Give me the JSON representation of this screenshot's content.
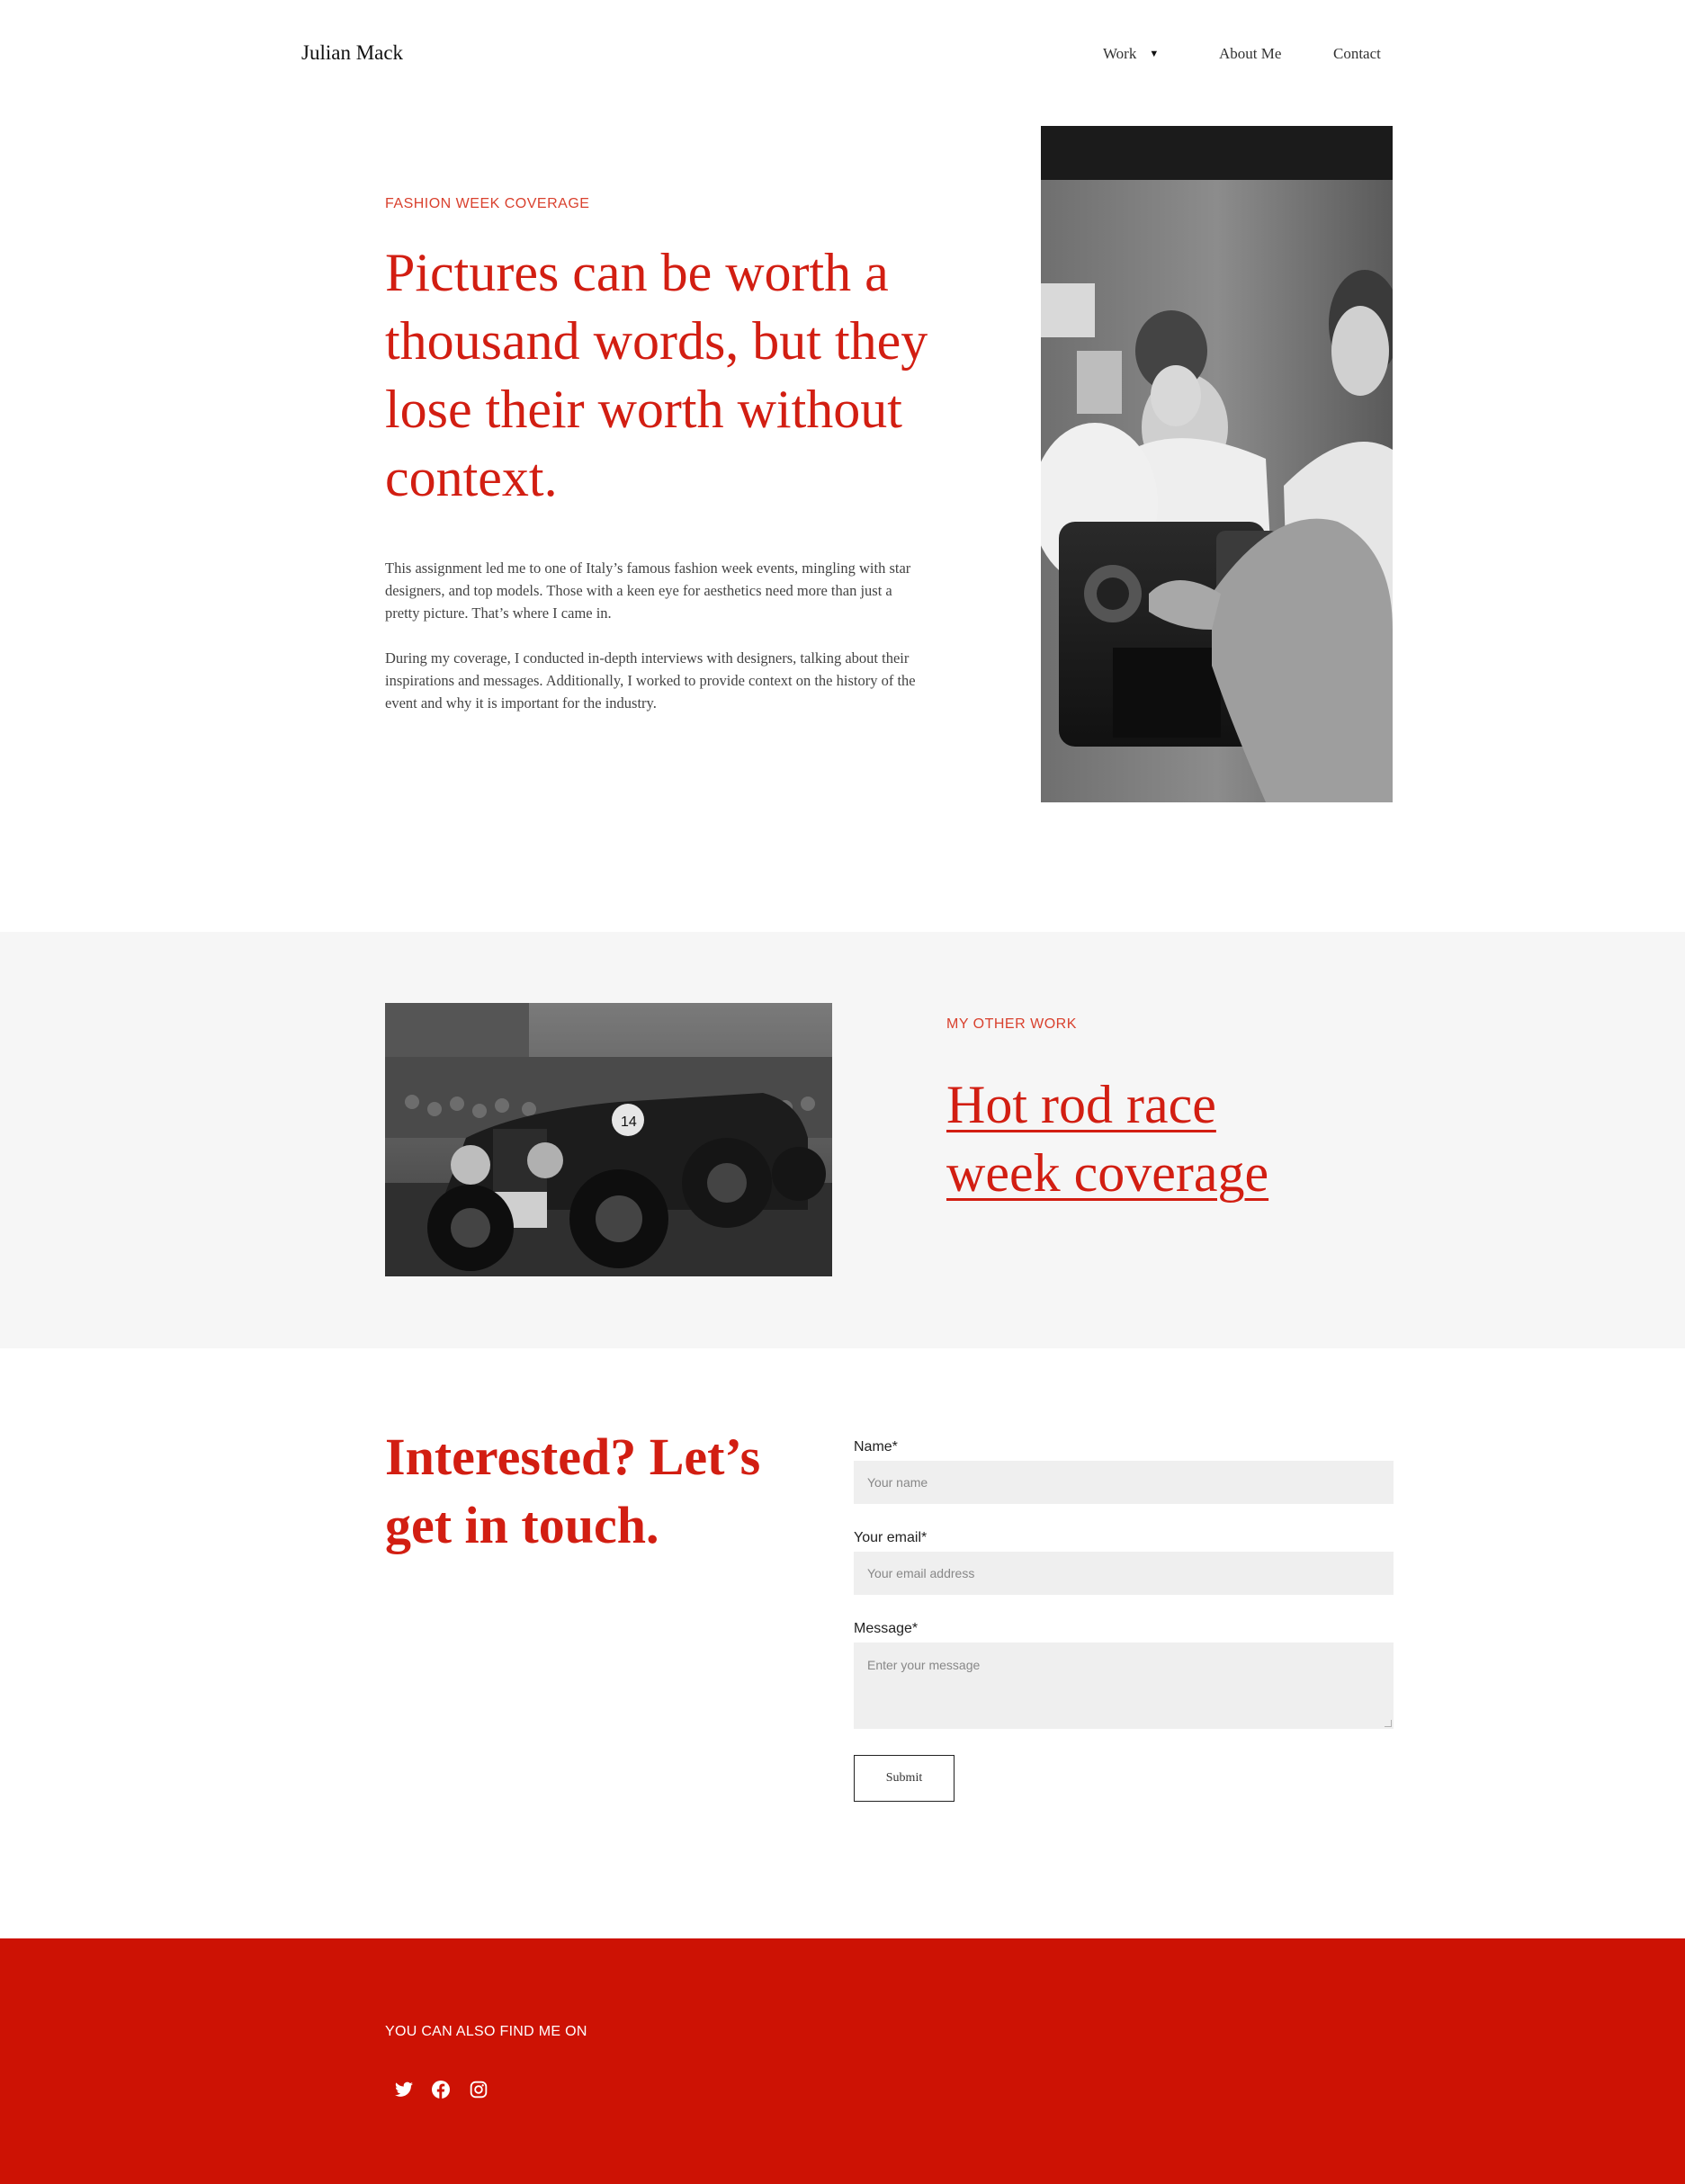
{
  "header": {
    "site_title": "Julian Mack",
    "nav": {
      "work": "Work",
      "about": "About Me",
      "contact": "Contact"
    }
  },
  "hero": {
    "kicker": "FASHION WEEK COVERAGE",
    "title": "Pictures can be worth a thousand words, but they lose their worth without context.",
    "paragraphs": [
      "This assignment led me to one of Italy’s famous fashion week events, mingling with star designers, and top models. Those with a keen eye for aesthetics need more than just a pretty picture. That’s where I came in.",
      "During my coverage, I conducted in-depth interviews with designers, talking about their inspirations and messages. Additionally, I worked to provide context on the history of the event and why it is important for the industry."
    ]
  },
  "other_work": {
    "kicker": "MY OTHER WORK",
    "link": "Hot rod race week coverage"
  },
  "contact": {
    "title": "Interested? Let’s get in touch.",
    "name_label": "Name*",
    "name_placeholder": "Your name",
    "email_label": "Your email*",
    "email_placeholder": "Your email address",
    "message_label": "Message*",
    "message_placeholder": "Enter your message",
    "submit_label": "Submit"
  },
  "footer": {
    "kicker": "YOU CAN ALSO FIND ME ON",
    "social_icons": [
      "twitter-icon",
      "facebook-icon",
      "instagram-icon"
    ]
  },
  "colors": {
    "accent": "#d21e12",
    "footer_bg": "#cd1204",
    "band_bg": "#f6f6f6",
    "input_bg": "#efefef"
  }
}
